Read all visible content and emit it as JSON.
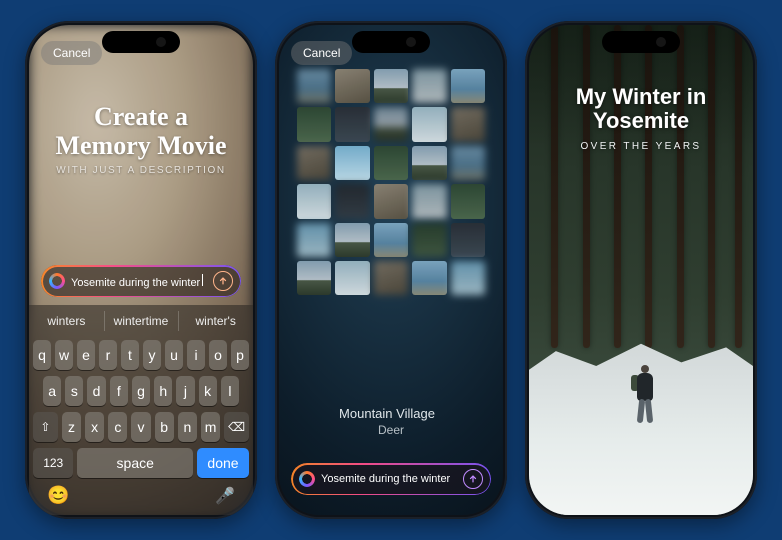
{
  "phone1": {
    "cancel": "Cancel",
    "title": "Create a Memory Movie",
    "subtitle": "WITH JUST A DESCRIPTION",
    "input_value": "Yosemite during the winter",
    "suggestions": [
      "winters",
      "wintertime",
      "winter's"
    ],
    "keyboard": {
      "row1": [
        "q",
        "w",
        "e",
        "r",
        "t",
        "y",
        "u",
        "i",
        "o",
        "p"
      ],
      "row2": [
        "a",
        "s",
        "d",
        "f",
        "g",
        "h",
        "j",
        "k",
        "l"
      ],
      "row3": [
        "z",
        "x",
        "c",
        "v",
        "b",
        "n",
        "m"
      ],
      "shift_icon": "⇧",
      "delete_icon": "⌫",
      "numbers_label": "123",
      "space_label": "space",
      "done_label": "done",
      "emoji_icon": "😊",
      "mic_icon": "🎤"
    }
  },
  "phone2": {
    "cancel": "Cancel",
    "chapter_main": "Mountain Village",
    "chapter_faded": "",
    "chapter_sub": "Deer",
    "input_value": "Yosemite during the winter"
  },
  "phone3": {
    "title": "My Winter in Yosemite",
    "subtitle": "OVER THE YEARS"
  }
}
